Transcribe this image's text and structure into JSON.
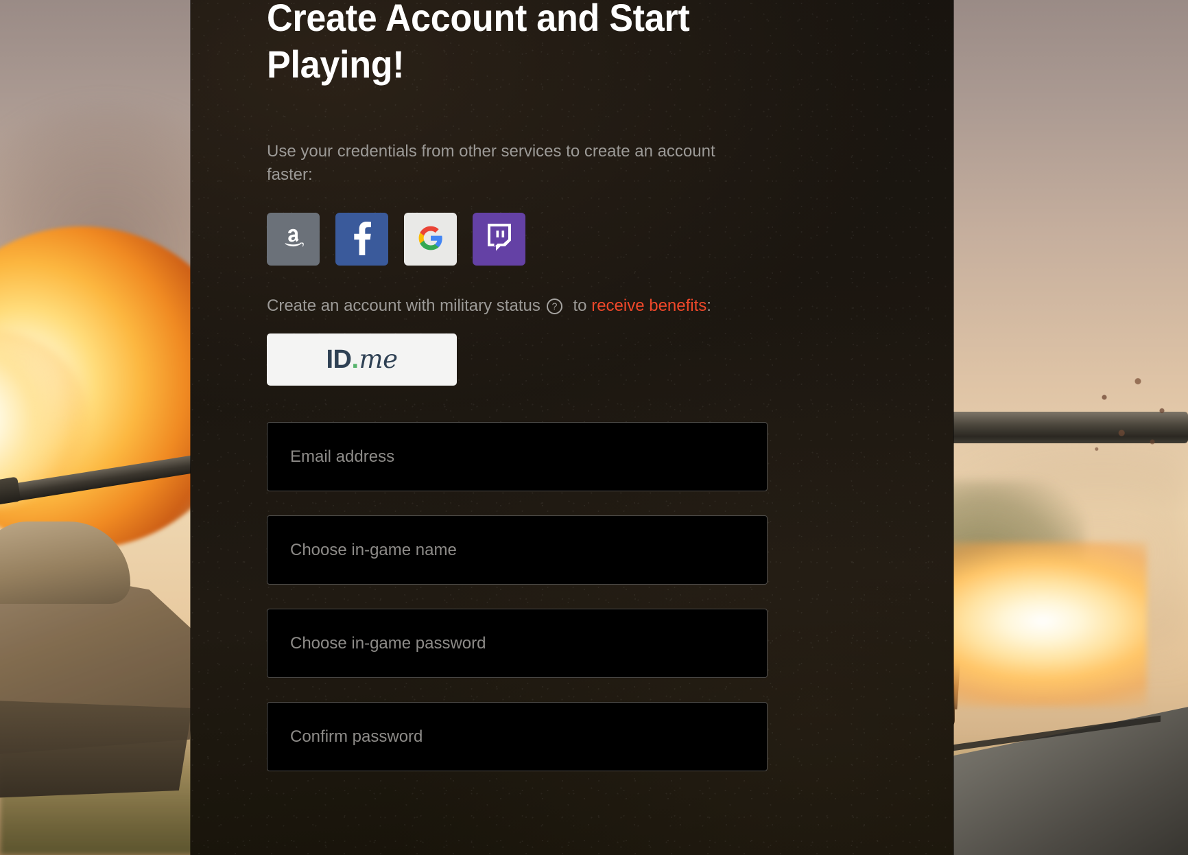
{
  "page": {
    "title": "Create Account and Start Playing!",
    "intro": "Use your credentials from other services to create an account faster:"
  },
  "social": {
    "heading": "Use your credentials from other services to create an account faster:",
    "buttons": [
      {
        "name": "amazon",
        "label": "Amazon",
        "icon": "amazon-icon",
        "color": "#6b7179"
      },
      {
        "name": "facebook",
        "label": "Facebook",
        "icon": "facebook-icon",
        "color": "#3a5a9b"
      },
      {
        "name": "google",
        "label": "Google",
        "icon": "google-icon",
        "color": "#e9e9e7"
      },
      {
        "name": "twitch",
        "label": "Twitch",
        "icon": "twitch-icon",
        "color": "#6441a5"
      }
    ]
  },
  "military": {
    "text_before": "Create an account with military status",
    "help_icon": "question-mark-circle-icon",
    "text_middle": " to ",
    "link_label": "receive benefits",
    "text_after": ":",
    "link_color": "#f0482a",
    "idme_button": {
      "icon": "idme-logo-icon",
      "logo_id": "ID",
      "logo_dot": ".",
      "logo_me": "me",
      "dot_color": "#57b46d",
      "text_color": "#2f4154"
    }
  },
  "form": {
    "fields": [
      {
        "name": "email-field",
        "placeholder": "Email address",
        "value": "",
        "type": "email"
      },
      {
        "name": "ingame-name-field",
        "placeholder": "Choose in-game name",
        "value": "",
        "type": "text"
      },
      {
        "name": "ingame-password-field",
        "placeholder": "Choose in-game password",
        "value": "",
        "type": "password"
      },
      {
        "name": "confirm-password-field",
        "placeholder": "Confirm password",
        "value": "",
        "type": "password"
      }
    ]
  },
  "theme": {
    "panel_bg": "#1b1610",
    "input_bg": "#000000",
    "input_border": "#4f4d4a",
    "body_text": "#9c9a97",
    "placeholder": "#8d8b88",
    "accent": "#f0482a",
    "heading": "#ffffff"
  },
  "background": {
    "scene": "world-war-tank-battle-explosion"
  }
}
